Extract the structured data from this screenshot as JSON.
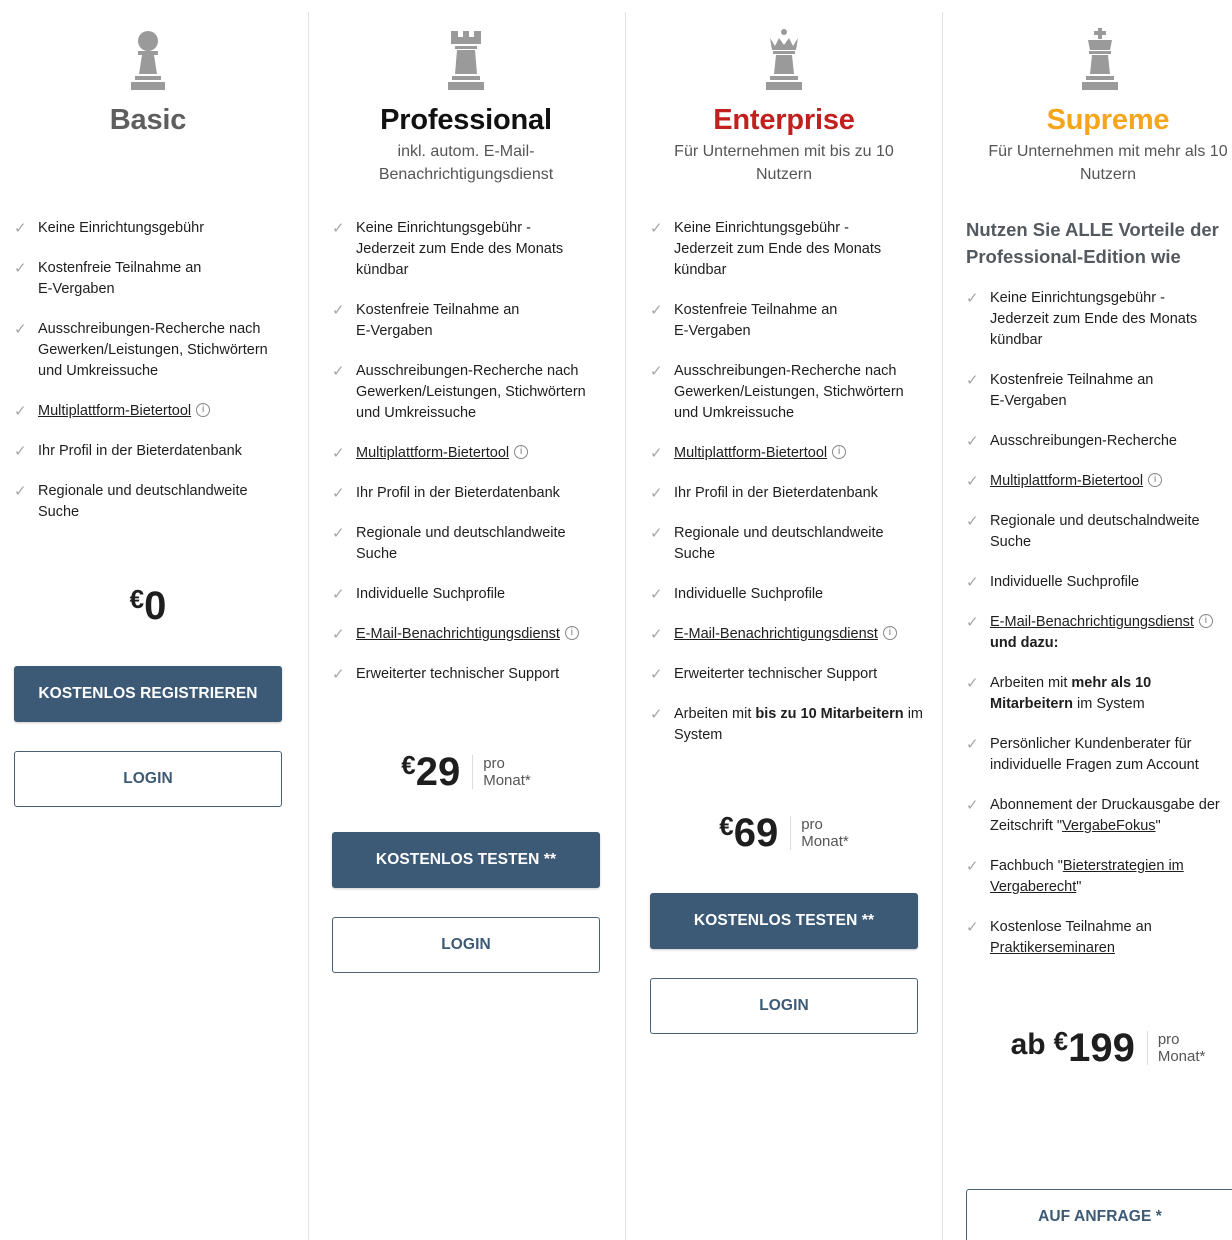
{
  "colors": {
    "basic": "#5e5e5e",
    "professional": "#111111",
    "enterprise": "#c2201f",
    "supreme": "#f5a51c",
    "button": "#3c5a76",
    "icon": "#9a9a9a"
  },
  "plans": [
    {
      "icon": "chess-pawn-icon",
      "title": "Basic",
      "subtitle": "",
      "features": [
        "Keine Einrichtungsgebühr",
        "Kostenfreie Teilnahme an E-Vergaben",
        "Ausschreibungen-Recherche nach Gewerken/Leistungen, Stichwörtern und Umkreissuche",
        "Multiplattform-Bietertool",
        "Ihr Profil in der Bieterdatenbank",
        "Regionale und deutschlandweite Suche"
      ],
      "price": {
        "currency": "€",
        "amount": "0"
      },
      "primary_button": "KOSTENLOS REGISTRIEREN",
      "secondary_button": "LOGIN"
    },
    {
      "icon": "chess-rook-icon",
      "title": "Professional",
      "subtitle": "inkl. autom. E-Mail-Benachrichtigungsdienst",
      "features": [
        "Keine Einrichtungsgebühr - Jederzeit zum Ende des Monats kündbar",
        "Kostenfreie Teilnahme an E-Vergaben",
        "Ausschreibungen-Recherche nach Gewerken/Leistungen, Stichwörtern und Umkreissuche",
        "Multiplattform-Bietertool",
        "Ihr Profil in der Bieterdatenbank",
        "Regionale und deutschlandweite Suche",
        "Individuelle Suchprofile",
        "E-Mail-Benachrichtigungsdienst",
        "Erweiterter technischer Support"
      ],
      "price": {
        "currency": "€",
        "amount": "29",
        "per_1": "pro",
        "per_2": "Monat*"
      },
      "primary_button": "KOSTENLOS TESTEN **",
      "secondary_button": "LOGIN"
    },
    {
      "icon": "chess-queen-icon",
      "title": "Enterprise",
      "subtitle": "Für Unternehmen mit bis zu 10 Nutzern",
      "features": [
        "Keine Einrichtungsgebühr - Jederzeit zum Ende des Monats kündbar",
        "Kostenfreie Teilnahme an E-Vergaben",
        "Ausschreibungen-Recherche nach Gewerken/Leistungen, Stichwörtern und Umkreissuche",
        "Multiplattform-Bietertool",
        "Ihr Profil in der Bieterdatenbank",
        "Regionale und deutschlandweite Suche",
        "Individuelle Suchprofile",
        "E-Mail-Benachrichtigungsdienst",
        "Erweiterter technischer Support"
      ],
      "feature_last": {
        "a": "Arbeiten mit ",
        "b": "bis zu 10 Mitarbeitern",
        "c": " im System"
      },
      "price": {
        "currency": "€",
        "amount": "69",
        "per_1": "pro",
        "per_2": "Monat*"
      },
      "primary_button": "KOSTENLOS TESTEN **",
      "secondary_button": "LOGIN"
    },
    {
      "icon": "chess-king-icon",
      "title": "Supreme",
      "subtitle": "Für Unternehmen mit mehr als 10 Nutzern",
      "intro": "Nutzen Sie ALLE Vorteile der Professional-Edition wie",
      "features": [
        "Keine Einrichtungsgebühr - Jederzeit zum Ende des Monats kündbar",
        "Kostenfreie Teilnahme an E-Vergaben",
        "Ausschreibungen-Recherche",
        "Multiplattform-Bietertool",
        "Regionale und deutschalndweite Suche",
        "Individuelle Suchprofile",
        "E-Mail-Benachrichtigungsdienst",
        "und dazu:",
        "Arbeiten mit ",
        "mehr als 10 Mitarbeitern",
        " im System",
        "Persönlicher Kundenberater für individuelle Fragen zum Account",
        "Abonnement der Druckausgabe der Zeitschrift \"",
        "VergabeFokus",
        "\"",
        "Fachbuch \"",
        "Bieterstrategien im Vergaberecht",
        "\"",
        "Kostenlose Teilnahme an ",
        "Praktikerseminaren"
      ],
      "price": {
        "prefix": "ab",
        "currency": "€",
        "amount": "199",
        "per_1": "pro",
        "per_2": "Monat*"
      },
      "secondary_button": "AUF ANFRAGE *"
    }
  ]
}
